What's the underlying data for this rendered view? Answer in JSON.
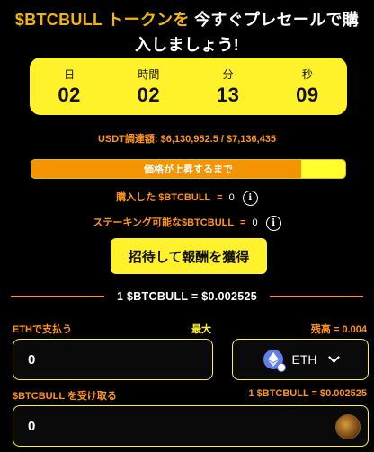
{
  "title": {
    "ticker": "$BTCBULL",
    "token_word": "トークンを",
    "rest": "今すぐプレセールで購入しましょう!"
  },
  "countdown": [
    {
      "label": "日",
      "value": "02"
    },
    {
      "label": "時間",
      "value": "02"
    },
    {
      "label": "分",
      "value": "13"
    },
    {
      "label": "秒",
      "value": "09"
    }
  ],
  "raised_text": "USDT調達額: $6,130,952.5 / $7,136,435",
  "progress": {
    "fraction": 0.859,
    "label": "価格が上昇するまで",
    "fill_color": "#f39400",
    "track_color": "#ffff2b"
  },
  "purchased": {
    "label": "購入した $BTCBULL",
    "eq": "=",
    "value": "0"
  },
  "staking": {
    "label": "ステーキング可能な$BTCBULL",
    "eq": "=",
    "value": "0"
  },
  "invite_button": "招待して報酬を獲得",
  "rate": "1 $BTCBULL = $0.002525",
  "pay": {
    "label": "ETHで支払う",
    "max_label": "最大",
    "balance": "残高 = 0.004",
    "value": "0",
    "token": "ETH",
    "token_icon": "ethereum-icon"
  },
  "receive": {
    "label": "$BTCBULL を受け取る",
    "rate": "1 $BTCBULL = $0.002525",
    "value": "0",
    "token_icon": "btcbull-icon"
  },
  "colors": {
    "accent_yellow": "#fff12a",
    "accent_orange": "#ff9416",
    "title_highlight": "#f2b704",
    "background": "#000000"
  }
}
